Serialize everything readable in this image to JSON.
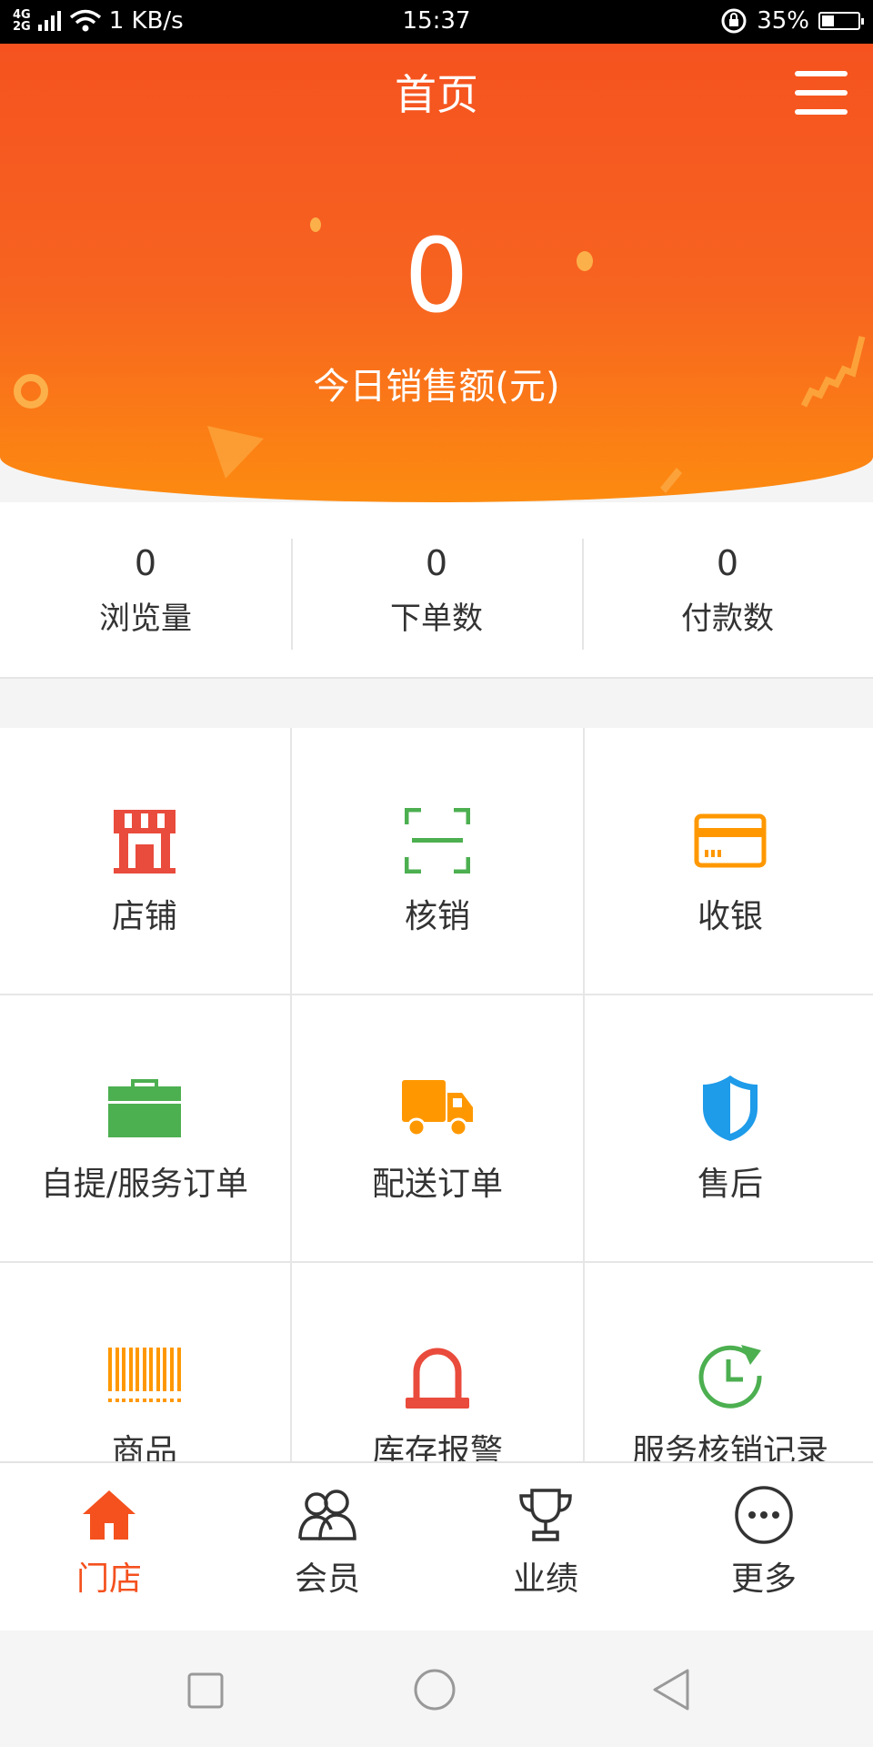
{
  "status_bar": {
    "network_top": "4G",
    "network_bottom": "2G",
    "speed": "1 KB/s",
    "time": "15:37",
    "battery": "35%",
    "battery_level": 0.35
  },
  "header": {
    "title": "首页",
    "sales_value": "0",
    "sales_label": "今日销售额(元)"
  },
  "stats": [
    {
      "value": "0",
      "label": "浏览量"
    },
    {
      "value": "0",
      "label": "下单数"
    },
    {
      "value": "0",
      "label": "付款数"
    }
  ],
  "grid": [
    {
      "label": "店铺",
      "icon": "store-icon"
    },
    {
      "label": "核销",
      "icon": "scan-icon"
    },
    {
      "label": "收银",
      "icon": "card-icon"
    },
    {
      "label": "自提/服务订单",
      "icon": "briefcase-icon"
    },
    {
      "label": "配送订单",
      "icon": "truck-icon"
    },
    {
      "label": "售后",
      "icon": "shield-icon"
    },
    {
      "label": "商品",
      "icon": "barcode-icon"
    },
    {
      "label": "库存报警",
      "icon": "alarm-icon"
    },
    {
      "label": "服务核销记录",
      "icon": "history-icon"
    }
  ],
  "tabs": [
    {
      "label": "门店",
      "icon": "home-icon",
      "active": true
    },
    {
      "label": "会员",
      "icon": "members-icon"
    },
    {
      "label": "业绩",
      "icon": "trophy-icon"
    },
    {
      "label": "更多",
      "icon": "more-icon"
    }
  ],
  "colors": {
    "brand": "#f4511e",
    "header_top": "#f5521f",
    "header_bottom": "#fd8b10",
    "store": "#e94b3c",
    "scan": "#4caf50",
    "card": "#ff9800",
    "briefcase": "#4caf50",
    "truck": "#ff9800",
    "shield": "#1e9be9",
    "barcode": "#ff9800",
    "alarm": "#e94b3c",
    "history": "#4caf50"
  }
}
